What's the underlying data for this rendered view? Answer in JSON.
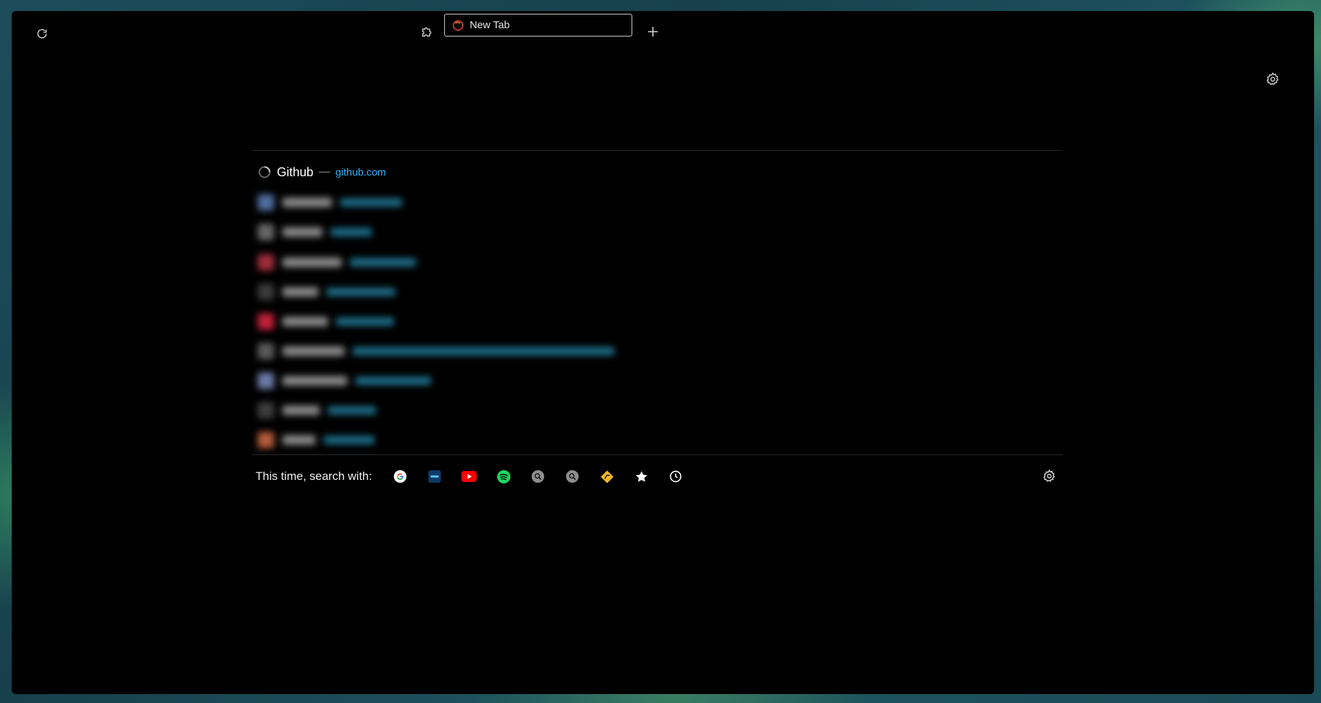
{
  "toolbar": {
    "reload_icon": "reload-icon",
    "extensions_icon": "puzzle-icon",
    "new_tab_icon": "plus-icon",
    "settings_icon": "gear-icon"
  },
  "tab": {
    "title": "New Tab",
    "icon": "firefox-icon"
  },
  "results": {
    "first": {
      "title": "Github",
      "separator": "—",
      "url": "github.com"
    }
  },
  "search_bar": {
    "label": "This time, search with:",
    "engines": [
      {
        "name": "google",
        "icon": "google-icon"
      },
      {
        "name": "search-engine-2",
        "icon": "blue-bar-icon"
      },
      {
        "name": "youtube",
        "icon": "youtube-icon"
      },
      {
        "name": "spotify",
        "icon": "spotify-icon"
      },
      {
        "name": "search-engine-5",
        "icon": "magnifier-icon"
      },
      {
        "name": "search-engine-6",
        "icon": "magnifier-icon"
      },
      {
        "name": "search-engine-7",
        "icon": "yellow-diamond-icon"
      },
      {
        "name": "bookmarks",
        "icon": "star-icon"
      },
      {
        "name": "history",
        "icon": "clock-icon"
      }
    ],
    "settings_icon": "gear-icon"
  },
  "colors": {
    "url": "#2ab4ff",
    "background": "#000000"
  }
}
